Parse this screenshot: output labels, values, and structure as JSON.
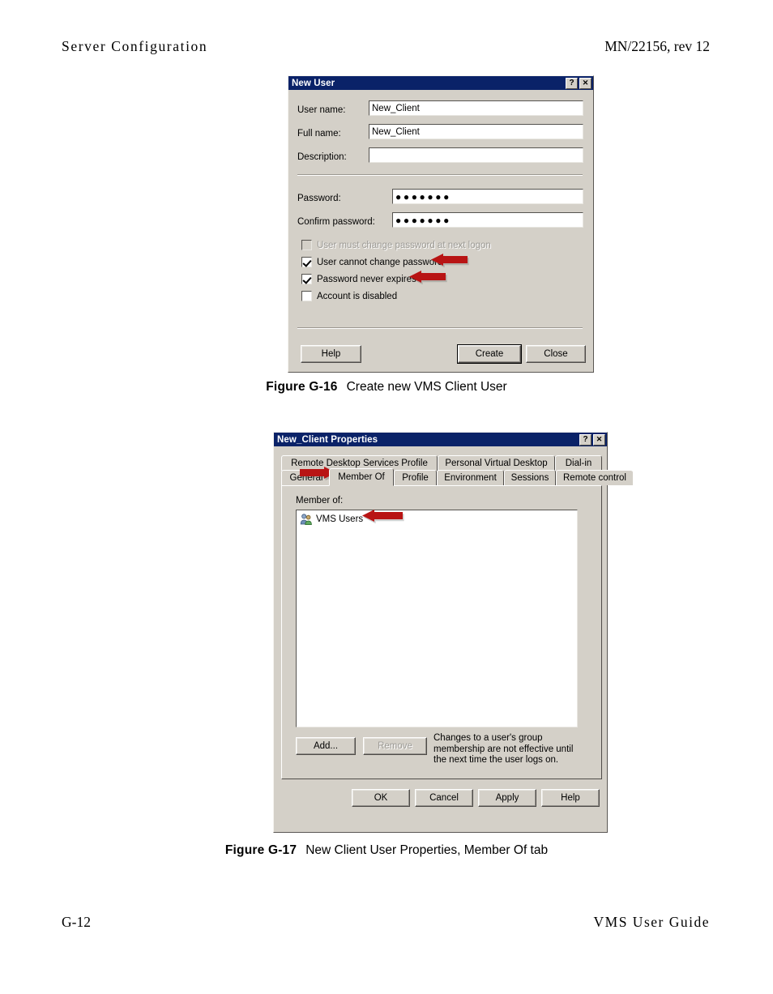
{
  "page": {
    "header_left": "Server Configuration",
    "header_right": "MN/22156, rev 12",
    "footer_left": "G-12",
    "footer_right": "VMS User Guide",
    "accent_red": "#b81414",
    "titlebar_blue": "#0a2268",
    "dialog_face": "#d4d0c8"
  },
  "figure_16": {
    "number": "Figure G-16",
    "text": "Create new VMS Client User"
  },
  "figure_17": {
    "number": "Figure G-17",
    "text": "New Client User Properties, Member Of tab"
  },
  "new_user_dialog": {
    "title": "New User",
    "help_button_icon": "?",
    "close_button_icon": "✕",
    "fields": [
      {
        "label": "User name:",
        "value": "New_Client"
      },
      {
        "label": "Full name:",
        "value": "New_Client"
      },
      {
        "label": "Description:",
        "value": ""
      }
    ],
    "password_fields": [
      {
        "label": "Password:",
        "value": "●●●●●●●"
      },
      {
        "label": "Confirm password:",
        "value": "●●●●●●●"
      }
    ],
    "checkboxes": [
      {
        "label": "User must change password at next logon",
        "checked": false,
        "disabled": true
      },
      {
        "label": "User cannot change password",
        "checked": true,
        "disabled": false
      },
      {
        "label": "Password never expires",
        "checked": true,
        "disabled": false
      },
      {
        "label": "Account is disabled",
        "checked": false,
        "disabled": false
      }
    ],
    "buttons": {
      "help": "Help",
      "create": "Create",
      "close": "Close"
    }
  },
  "properties_dialog": {
    "title": "New_Client Properties",
    "help_button_icon": "?",
    "close_button_icon": "✕",
    "tabs_row1": [
      "Remote Desktop Services Profile",
      "Personal Virtual Desktop",
      "Dial-in"
    ],
    "tabs_row2": [
      "General",
      "Member Of",
      "Profile",
      "Environment",
      "Sessions",
      "Remote control"
    ],
    "active_tab": "Member Of",
    "member_of_label": "Member of:",
    "member_list": [
      {
        "name": "VMS Users",
        "icon": "group-icon"
      }
    ],
    "add_button": "Add...",
    "remove_button": "Remove",
    "remove_disabled": true,
    "note": "Changes to a user's group membership are not effective until the next time the user logs on.",
    "footer_buttons": {
      "ok": "OK",
      "cancel": "Cancel",
      "apply": "Apply",
      "help": "Help"
    }
  }
}
